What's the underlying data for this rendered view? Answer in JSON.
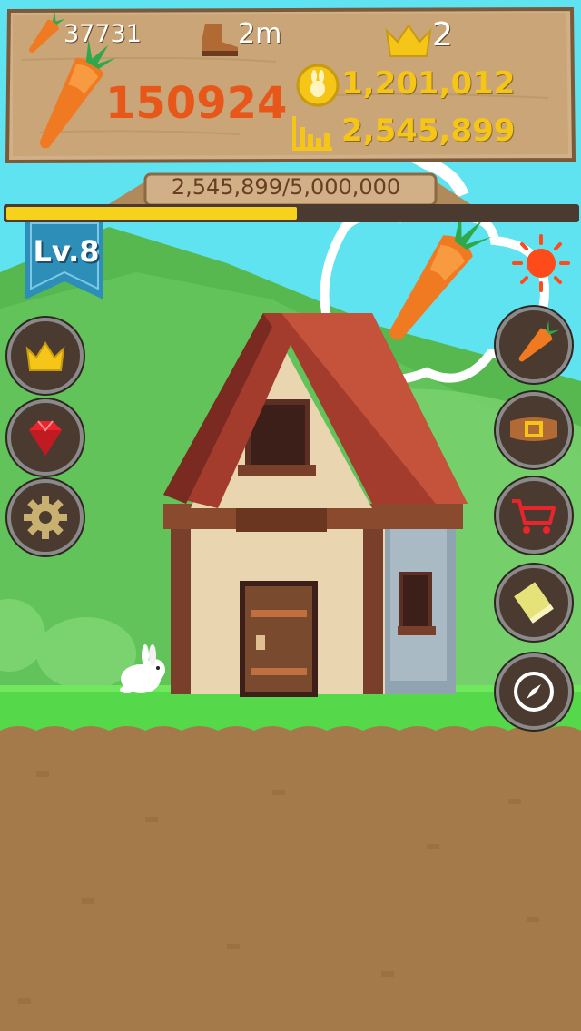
{
  "hud": {
    "carrots_per_tap": "37731",
    "distance": "2m",
    "crowns": "2",
    "carrot_total": "150924",
    "coins": "1,201,012",
    "income": "2,545,899"
  },
  "progress": {
    "label": "2,545,899/5,000,000",
    "fraction": 0.509
  },
  "level": {
    "label": "Lv.8"
  },
  "left_buttons": [
    {
      "icon": "crown-icon"
    },
    {
      "icon": "gem-icon"
    },
    {
      "icon": "gear-icon"
    }
  ],
  "right_buttons": [
    {
      "icon": "carrot-icon"
    },
    {
      "icon": "belt-icon"
    },
    {
      "icon": "cart-icon"
    },
    {
      "icon": "book-icon"
    },
    {
      "icon": "compass-icon"
    }
  ],
  "colors": {
    "sky": "#5fe3f0",
    "grass": "#55d84a",
    "dirt": "#a57a4b",
    "wood": "#c9a577",
    "carrot_orange": "#e8571a",
    "coin_gold": "#f5c518"
  }
}
